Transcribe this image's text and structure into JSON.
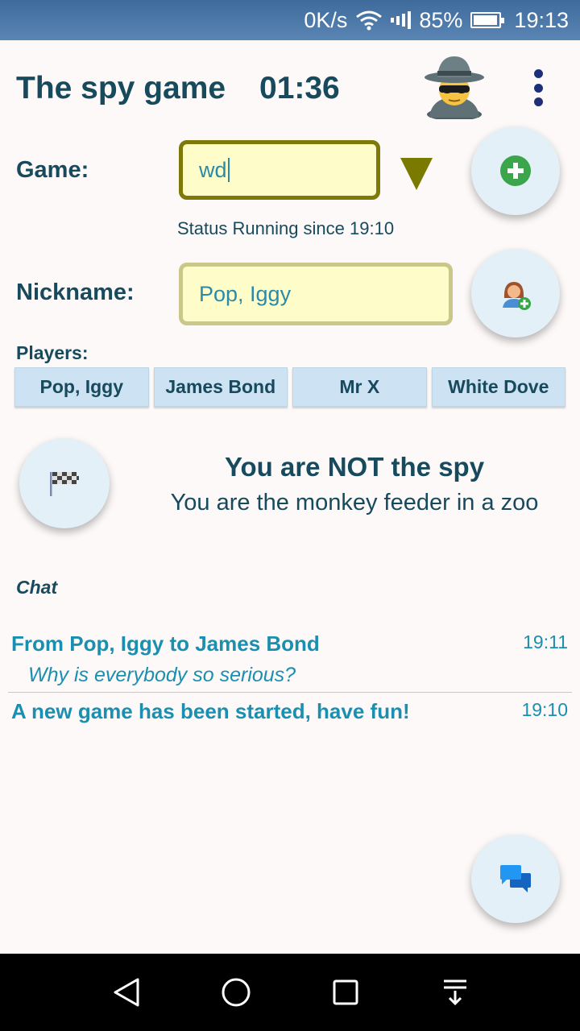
{
  "status_bar": {
    "speed": "0K/s",
    "battery": "85%",
    "battery_level": 0.85,
    "time": "19:13",
    "icons": [
      "wifi-icon",
      "signal-icon",
      "battery-icon"
    ]
  },
  "header": {
    "title": "The spy game",
    "timer": "01:36",
    "avatar_icon": "spy-icon",
    "menu_icon": "more-vert-icon"
  },
  "game": {
    "label": "Game:",
    "value": "wd",
    "dropdown_icon": "triangle-down-icon",
    "new_game_icon": "plus-circle-icon",
    "status": "Status Running since 19:10"
  },
  "nickname": {
    "label": "Nickname:",
    "value": "Pop, Iggy",
    "add_player_icon": "person-add-icon"
  },
  "players": {
    "label": "Players:",
    "list": [
      "Pop, Iggy",
      "James Bond",
      "Mr X",
      "White Dove"
    ]
  },
  "role": {
    "finish_icon": "checkered-flag-icon",
    "title": "You are NOT the spy",
    "description": "You are the monkey feeder in a zoo"
  },
  "chat": {
    "label": "Chat",
    "messages": [
      {
        "header": "From Pop, Iggy to James Bond",
        "time": "19:11",
        "body": "Why is everybody so serious?"
      },
      {
        "header": "A new game has been started, have fun!",
        "time": "19:10",
        "body": ""
      }
    ],
    "chat_icon": "chat-bubbles-icon"
  },
  "nav": {
    "icons": [
      "back-icon",
      "home-icon",
      "recents-icon",
      "notifications-down-icon"
    ]
  },
  "colors": {
    "primary_text": "#174a5c",
    "chat_text": "#1b8fb0",
    "field_bg": "#fefdc9",
    "chip_bg": "#cde2f2",
    "fab_bg": "#e3f0f7",
    "status_bar": "#4a76a6"
  }
}
